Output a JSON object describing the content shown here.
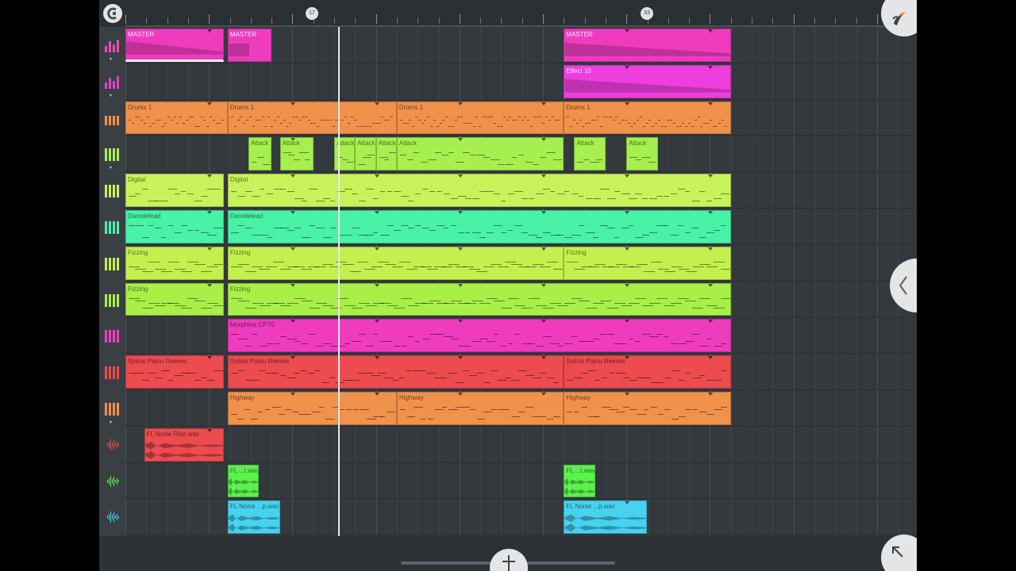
{
  "colors": {
    "background": "#34393e",
    "ruler": "#2b3035",
    "playhead": "#e8eaec",
    "magenta": "#ef3cbf",
    "orange": "#f0914c",
    "lime": "#c8f25a",
    "mint": "#48f2a6",
    "red": "#ec4b4f",
    "green": "#5cf04d",
    "cyan": "#47d2ef"
  },
  "ruler": {
    "markers": [
      "17",
      "33"
    ]
  },
  "tracks": [
    {
      "icon": "mixer-bars-icon",
      "color": "#e84bb0",
      "collapse": true
    },
    {
      "icon": "mixer-bars-icon",
      "color": "#d846c8",
      "collapse": true
    },
    {
      "icon": "drum-pads-icon",
      "color": "#f0914c",
      "collapse": false
    },
    {
      "icon": "keyboard-icon",
      "color": "#a6ef4e",
      "collapse": true
    },
    {
      "icon": "keyboard-icon",
      "color": "#c8f25a",
      "collapse": false
    },
    {
      "icon": "keyboard-icon",
      "color": "#48f2a6",
      "collapse": false
    },
    {
      "icon": "keyboard-icon",
      "color": "#c3f04e",
      "collapse": false
    },
    {
      "icon": "keyboard-icon",
      "color": "#a8ef48",
      "collapse": false
    },
    {
      "icon": "keyboard-icon",
      "color": "#ef3cbf",
      "collapse": false
    },
    {
      "icon": "keyboard-icon",
      "color": "#ec4b4f",
      "collapse": false
    },
    {
      "icon": "keyboard-icon",
      "color": "#f0914c",
      "collapse": true
    },
    {
      "icon": "waveform-icon",
      "color": "#ec4b4f",
      "collapse": false
    },
    {
      "icon": "waveform-icon",
      "color": "#5cf04d",
      "collapse": false
    },
    {
      "icon": "waveform-icon",
      "color": "#47d2ef",
      "collapse": false
    }
  ],
  "clips": [
    {
      "track": 0,
      "start": 0,
      "end": 4.7,
      "label": "MASTER",
      "color": "#ef3cbf",
      "kind": "automation",
      "selected": true
    },
    {
      "track": 0,
      "start": 4.9,
      "end": 7.0,
      "label": "MASTER",
      "color": "#ef3cbf",
      "kind": "automation-short"
    },
    {
      "track": 0,
      "start": 21.0,
      "end": 29.0,
      "label": "MASTER",
      "color": "#ef3cbf",
      "kind": "automation"
    },
    {
      "track": 1,
      "start": 21.0,
      "end": 29.0,
      "label": "Effect 10",
      "color": "#ee3ede",
      "kind": "automation"
    },
    {
      "track": 2,
      "start": 0,
      "end": 4.9,
      "label": "Drums 1",
      "color": "#f0914c",
      "kind": "drums"
    },
    {
      "track": 2,
      "start": 4.9,
      "end": 13.0,
      "label": "Drums 1",
      "color": "#f0914c",
      "kind": "drums"
    },
    {
      "track": 2,
      "start": 13.0,
      "end": 21.0,
      "label": "Drums 1",
      "color": "#f0914c",
      "kind": "drums"
    },
    {
      "track": 2,
      "start": 21.0,
      "end": 29.0,
      "label": "Drums 1",
      "color": "#f0914c",
      "kind": "drums"
    },
    {
      "track": 3,
      "start": 5.9,
      "end": 7.0,
      "label": "Attack",
      "color": "#a6ef4e",
      "kind": "notes"
    },
    {
      "track": 3,
      "start": 7.4,
      "end": 9.0,
      "label": "Attack",
      "color": "#a6ef4e",
      "kind": "notes"
    },
    {
      "track": 3,
      "start": 10.0,
      "end": 11.0,
      "label": "Attack",
      "color": "#a6ef4e",
      "kind": "notes"
    },
    {
      "track": 3,
      "start": 11.0,
      "end": 12.0,
      "label": "Attack",
      "color": "#a6ef4e",
      "kind": "notes"
    },
    {
      "track": 3,
      "start": 12.0,
      "end": 13.0,
      "label": "Attack",
      "color": "#a6ef4e",
      "kind": "notes"
    },
    {
      "track": 3,
      "start": 13.0,
      "end": 21.0,
      "label": "Attack",
      "color": "#a6ef4e",
      "kind": "notes"
    },
    {
      "track": 3,
      "start": 21.5,
      "end": 23.0,
      "label": "Attack",
      "color": "#a6ef4e",
      "kind": "notes"
    },
    {
      "track": 3,
      "start": 24.0,
      "end": 25.5,
      "label": "Attack",
      "color": "#a6ef4e",
      "kind": "notes"
    },
    {
      "track": 4,
      "start": 0,
      "end": 4.7,
      "label": "Digital",
      "color": "#c8f25a",
      "kind": "notes"
    },
    {
      "track": 4,
      "start": 4.9,
      "end": 29.0,
      "label": "Digital",
      "color": "#c8f25a",
      "kind": "notes"
    },
    {
      "track": 5,
      "start": 0,
      "end": 4.7,
      "label": "Daredelead",
      "color": "#48f2a6",
      "kind": "notes"
    },
    {
      "track": 5,
      "start": 4.9,
      "end": 29.0,
      "label": "Daredelead",
      "color": "#48f2a6",
      "kind": "notes"
    },
    {
      "track": 6,
      "start": 0,
      "end": 4.7,
      "label": "Fizzing",
      "color": "#c3f04e",
      "kind": "chords"
    },
    {
      "track": 6,
      "start": 4.9,
      "end": 21.0,
      "label": "Fizzing",
      "color": "#c3f04e",
      "kind": "chords"
    },
    {
      "track": 6,
      "start": 21.0,
      "end": 29.0,
      "label": "Fizzing",
      "color": "#c3f04e",
      "kind": "chords"
    },
    {
      "track": 7,
      "start": 0,
      "end": 4.7,
      "label": "Fizzing",
      "color": "#a8ef48",
      "kind": "chords"
    },
    {
      "track": 7,
      "start": 4.9,
      "end": 29.0,
      "label": "Fizzing",
      "color": "#a8ef48",
      "kind": "chords"
    },
    {
      "track": 8,
      "start": 4.9,
      "end": 29.0,
      "label": "Morphine CP70",
      "color": "#ef3cbf",
      "kind": "notes"
    },
    {
      "track": 9,
      "start": 0,
      "end": 4.7,
      "label": "Sytrus Pianu Reeves",
      "color": "#ec4b4f",
      "kind": "notes"
    },
    {
      "track": 9,
      "start": 4.9,
      "end": 21.0,
      "label": "Sytrus Pianu Reeves",
      "color": "#ec4b4f",
      "kind": "notes"
    },
    {
      "track": 9,
      "start": 21.0,
      "end": 29.0,
      "label": "Sytrus Pianu Reeves",
      "color": "#ec4b4f",
      "kind": "notes"
    },
    {
      "track": 10,
      "start": 4.9,
      "end": 13.0,
      "label": "Highway",
      "color": "#f0914c",
      "kind": "notes"
    },
    {
      "track": 10,
      "start": 13.0,
      "end": 21.0,
      "label": "Highway",
      "color": "#f0914c",
      "kind": "notes"
    },
    {
      "track": 10,
      "start": 21.0,
      "end": 29.0,
      "label": "Highway",
      "color": "#f0914c",
      "kind": "notes"
    },
    {
      "track": 11,
      "start": 0.9,
      "end": 4.7,
      "label": "FL Noise Rise.wav",
      "color": "#ec4b4f",
      "kind": "audio"
    },
    {
      "track": 12,
      "start": 4.9,
      "end": 6.4,
      "label": "FL ...t.wav",
      "color": "#5cf04d",
      "kind": "audio"
    },
    {
      "track": 12,
      "start": 21.0,
      "end": 22.5,
      "label": "FL ...t.wav",
      "color": "#5cf04d",
      "kind": "audio"
    },
    {
      "track": 13,
      "start": 4.9,
      "end": 7.4,
      "label": "FL Noise ...p.wav",
      "color": "#47d2ef",
      "kind": "audio"
    },
    {
      "track": 13,
      "start": 21.0,
      "end": 25.0,
      "label": "FL Noise ...p.wav",
      "color": "#47d2ef",
      "kind": "audio"
    }
  ],
  "buttons": {
    "snap": "snap-magnet-icon",
    "fl_menu": "fl-fruit-logo-icon",
    "collapse": "chevron-left-icon",
    "expand": "arrow-up-left-icon",
    "add": "plus-icon"
  }
}
